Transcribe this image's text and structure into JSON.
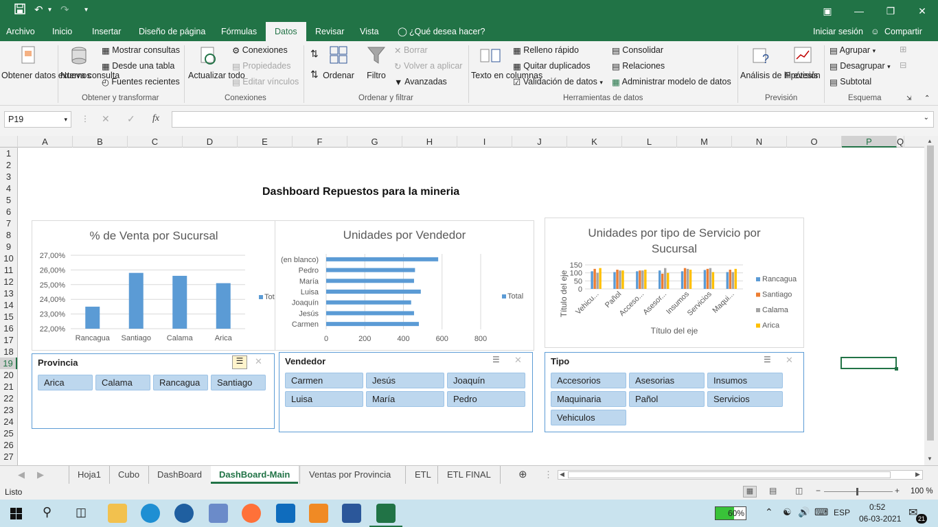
{
  "window": {
    "qa_save": "💾",
    "qa_undo": "↶",
    "qa_redo": "↷",
    "qa_more": "▾",
    "min": "—",
    "max": "❐",
    "close": "✕",
    "restore": "▣"
  },
  "menu": {
    "items": [
      "Archivo",
      "Inicio",
      "Insertar",
      "Diseño de página",
      "Fórmulas",
      "Datos",
      "Revisar",
      "Vista"
    ],
    "tell_me": "¿Qué desea hacer?",
    "signin": "Iniciar sesión",
    "share": "Compartir"
  },
  "ribbon": {
    "obtener": "Obtener datos externos",
    "nueva": "Nueva consulta",
    "mostrar": "Mostrar consultas",
    "desde_tabla": "Desde una tabla",
    "fuentes": "Fuentes recientes",
    "grp_obtener": "Obtener y transformar",
    "actualizar": "Actualizar todo",
    "conexiones": "Conexiones",
    "propiedades": "Propiedades",
    "editar": "Editar vínculos",
    "grp_conexiones": "Conexiones",
    "ordenar": "Ordenar",
    "filtro": "Filtro",
    "borrar": "Borrar",
    "volver": "Volver a aplicar",
    "avanzadas": "Avanzadas",
    "grp_ordenar": "Ordenar y filtrar",
    "texto_col": "Texto en columnas",
    "relleno": "Relleno rápido",
    "quitar": "Quitar duplicados",
    "validacion": "Validación de datos",
    "consolidar": "Consolidar",
    "relaciones": "Relaciones",
    "administrar": "Administrar modelo de datos",
    "grp_herr": "Herramientas de datos",
    "analisis": "Análisis de hipótesis",
    "prevision": "Previsión",
    "grp_prev": "Previsión",
    "agrupar": "Agrupar",
    "desagrupar": "Desagrupar",
    "subtotal": "Subtotal",
    "grp_esquema": "Esquema"
  },
  "formula": {
    "namebox": "P19",
    "fx": "fx",
    "cancel": "✕",
    "confirm": "✓",
    "value": ""
  },
  "columns": [
    "A",
    "B",
    "C",
    "D",
    "E",
    "F",
    "G",
    "H",
    "I",
    "J",
    "K",
    "L",
    "M",
    "N",
    "O",
    "P",
    "Q"
  ],
  "rows": [
    "1",
    "2",
    "3",
    "4",
    "5",
    "6",
    "7",
    "8",
    "9",
    "10",
    "11",
    "12",
    "13",
    "14",
    "15",
    "16",
    "17",
    "18",
    "19",
    "20",
    "21",
    "22",
    "23",
    "24",
    "25",
    "26",
    "27"
  ],
  "dashboard_title": "Dashboard Repuestos para la mineria",
  "chart_data": [
    {
      "type": "bar",
      "title": "% de Venta por Sucursal",
      "categories": [
        "Rancagua",
        "Santiago",
        "Calama",
        "Arica"
      ],
      "values": [
        23.5,
        25.8,
        25.6,
        25.1
      ],
      "ylim": [
        22,
        27
      ],
      "yticks": [
        "27,00%",
        "26,00%",
        "25,00%",
        "24,00%",
        "23,00%",
        "22,00%"
      ],
      "legend": [
        "Tot"
      ],
      "legend_position": "right",
      "color": "#5b9bd5"
    },
    {
      "type": "bar",
      "orientation": "horizontal",
      "title": "Unidades por Vendedor",
      "categories": [
        "(en blanco)",
        "Pedro",
        "María",
        "Luisa",
        "Joaquín",
        "Jesús",
        "Carmen"
      ],
      "values": [
        580,
        460,
        455,
        490,
        440,
        455,
        480
      ],
      "xlim": [
        0,
        800
      ],
      "xticks": [
        "0",
        "200",
        "400",
        "600",
        "800"
      ],
      "legend": [
        "Total"
      ],
      "legend_position": "right",
      "color": "#5b9bd5"
    },
    {
      "type": "bar",
      "title": "Unidades por tipo de Servicio por Sucursal",
      "categories": [
        "Vehicu...",
        "Pañol",
        "Acceso...",
        "Asesor...",
        "Insumos",
        "Servicios",
        "Maqui..."
      ],
      "ylabel": "Título del eje",
      "xlabel": "Título del eje",
      "ylim": [
        0,
        150
      ],
      "yticks": [
        "150",
        "100",
        "50",
        "0"
      ],
      "legend_position": "right",
      "series": [
        {
          "name": "Rancagua",
          "color": "#5b9bd5",
          "values": [
            110,
            105,
            110,
            115,
            110,
            118,
            105
          ]
        },
        {
          "name": "Santiago",
          "color": "#ed7d31",
          "values": [
            125,
            120,
            115,
            95,
            130,
            125,
            120
          ]
        },
        {
          "name": "Calama",
          "color": "#a5a5a5",
          "values": [
            100,
            115,
            115,
            130,
            125,
            130,
            105
          ]
        },
        {
          "name": "Arica",
          "color": "#ffc000",
          "values": [
            130,
            115,
            120,
            100,
            120,
            105,
            125
          ]
        }
      ]
    }
  ],
  "slicers": [
    {
      "title": "Provincia",
      "items": [
        "Arica",
        "Calama",
        "Rancagua",
        "Santiago"
      ]
    },
    {
      "title": "Vendedor",
      "items": [
        "Carmen",
        "Jesús",
        "Joaquín",
        "Luisa",
        "María",
        "Pedro"
      ]
    },
    {
      "title": "Tipo",
      "items": [
        "Accesorios",
        "Asesorias",
        "Insumos",
        "Maquinaria",
        "Pañol",
        "Servicios",
        "Vehiculos"
      ]
    }
  ],
  "sheets": [
    "Hoja1",
    "Cubo",
    "DashBoard",
    "DashBoard-Main",
    "Ventas por Provincia",
    "ETL",
    "ETL FINAL"
  ],
  "active_sheet": "DashBoard-Main",
  "status": {
    "ready": "Listo",
    "zoom": "100 %",
    "zoom_minus": "−",
    "zoom_plus": "+"
  },
  "taskbar": {
    "battery": "60%",
    "lang": "ESP",
    "time": "0:52",
    "date": "06-03-2021",
    "notifications": "21"
  }
}
